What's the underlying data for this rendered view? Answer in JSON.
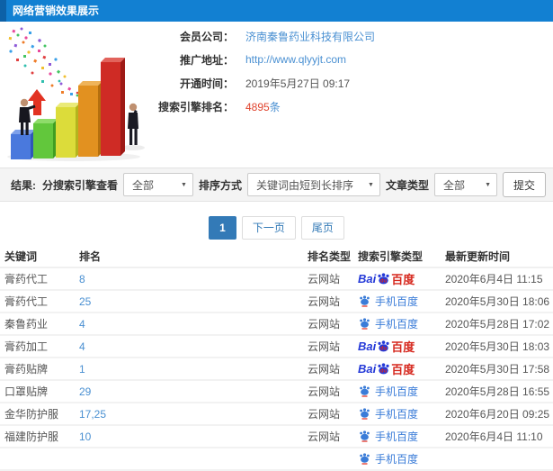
{
  "window": {
    "title": "网络营销效果展示"
  },
  "info": {
    "company_label": "会员公司：",
    "company_value": "济南秦鲁药业科技有限公司",
    "url_label": "推广地址：",
    "url_value": "http://www.qlyyjt.com",
    "open_time_label": "开通时间：",
    "open_time_value": "2019年5月27日 09:17",
    "rank_label": "搜索引擎排名：",
    "rank_count": "4895",
    "rank_unit": "条"
  },
  "filters": {
    "result_label": "结果:",
    "engine_view_label": "分搜索引擎查看",
    "engine_view_value": "全部",
    "sort_label": "排序方式",
    "sort_value": "关键词由短到长排序",
    "article_type_label": "文章类型",
    "article_type_value": "全部",
    "submit_label": "提交",
    "caret": "▼"
  },
  "pagination": {
    "page_current": "1",
    "next_label": "下一页",
    "last_label": "尾页"
  },
  "table": {
    "columns": {
      "keyword": "关键词",
      "rank": "排名",
      "rank_type": "排名类型",
      "engine_type": "搜索引擎类型",
      "updated": "最新更新时间"
    },
    "rows": [
      {
        "keyword": "膏药代工",
        "rank": "8",
        "rank_type": "云网站",
        "engine": "baidu",
        "engine_name": "百度",
        "updated": "2020年6月4日 11:15"
      },
      {
        "keyword": "膏药代工",
        "rank": "25",
        "rank_type": "云网站",
        "engine": "mbaidu",
        "engine_name": "手机百度",
        "updated": "2020年5月30日 18:06"
      },
      {
        "keyword": "秦鲁药业",
        "rank": "4",
        "rank_type": "云网站",
        "engine": "mbaidu",
        "engine_name": "手机百度",
        "updated": "2020年5月28日 17:02"
      },
      {
        "keyword": "膏药加工",
        "rank": "4",
        "rank_type": "云网站",
        "engine": "baidu",
        "engine_name": "百度",
        "updated": "2020年5月30日 18:03"
      },
      {
        "keyword": "膏药贴牌",
        "rank": "1",
        "rank_type": "云网站",
        "engine": "baidu",
        "engine_name": "百度",
        "updated": "2020年5月30日 17:58"
      },
      {
        "keyword": "口罩贴牌",
        "rank": "29",
        "rank_type": "云网站",
        "engine": "mbaidu",
        "engine_name": "手机百度",
        "updated": "2020年5月28日 16:55"
      },
      {
        "keyword": "金华防护服",
        "rank": "17,25",
        "rank_type": "云网站",
        "engine": "mbaidu",
        "engine_name": "手机百度",
        "updated": "2020年6月20日 09:25"
      },
      {
        "keyword": "福建防护服",
        "rank": "10",
        "rank_type": "云网站",
        "engine": "mbaidu",
        "engine_name": "手机百度",
        "updated": "2020年6月4日 11:10"
      },
      {
        "keyword": "",
        "rank": "",
        "rank_type": "",
        "engine": "mbaidu",
        "engine_name": "",
        "updated": ""
      }
    ]
  },
  "engine": {
    "baidu_bai": "Bai",
    "baidu_du": "du",
    "baidu_name": "百度",
    "mobile_name": "手机百度"
  },
  "colors": {
    "header_bg": "#1280d2",
    "accent_blue": "#4a90d2",
    "alert_red": "#e0452f",
    "baidu_blue": "#2439d8",
    "baidu_red": "#d6281e",
    "pagination_blue": "#337ab7"
  }
}
